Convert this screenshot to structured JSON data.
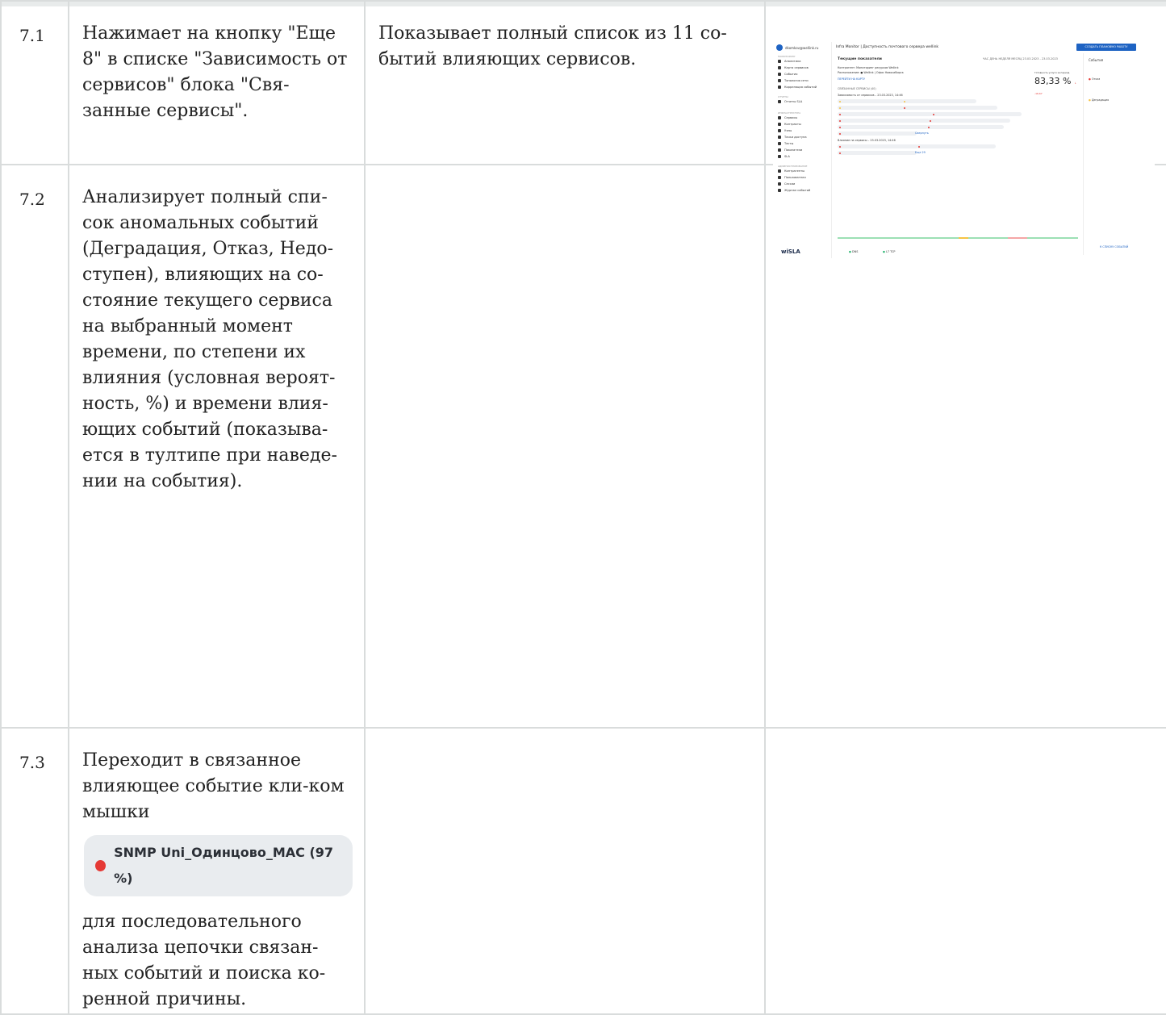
{
  "rows": [
    {
      "num": "7.1",
      "action": "Нажимает на кнопку \"Еще 8\" в списке \"Зависимость от сервисов\" блока \"Свя-занные сервисы\".",
      "result": "Показывает полный список из 11 со-бытий влияющих сервисов."
    },
    {
      "num": "7.2",
      "action": "Анализирует полный спи-сок аномальных событий (Деградация, Отказ, Недо-ступен), влияющих на со-стояние текущего сервиса на выбранный момент времени, по степени их влияния (условная вероят-ность, %) и времени влия-ющих событий (показыва-ется в тултипе при наведе-нии на события).",
      "result": ""
    },
    {
      "num": "7.3",
      "action_before": "Переходит в связанное влияющее событие кли-ком мышки",
      "chip": "SNMP Uni_Одинцово_MAC (97 %)",
      "action_after": "для последовательного анализа цепочки связан-ных событий и поиска ко-ренной причины.",
      "result": ""
    }
  ],
  "screenshot": {
    "user": "dkomkov@wellink.ru",
    "breadcrumb": "Infra Monitor | Доступность почтового сервера wellink",
    "create_button": "СОЗДАТЬ ПЛАНОВУЮ РАБОТУ",
    "sidebar": {
      "section_monitoring": "МОНИТОРИНГ",
      "items_monitoring": [
        "Аналитика",
        "Карта сервисов",
        "События",
        "Топология сети",
        "Корреляция событий"
      ],
      "section_reports": "ОТЧЕТЫ",
      "items_reports": [
        "Отчеты SLA"
      ],
      "section_infra": "ИНФРАСТРУКТУРА",
      "items_infra": [
        "Сервисы",
        "Контракты",
        "Узлы",
        "Точки доступа",
        "Тесты",
        "Показатели",
        "SLA"
      ],
      "section_admin": "АДМИНИСТРИРОВАНИЕ",
      "items_admin": [
        "Контрагенты",
        "Пользователи",
        "Сессии",
        "Журнал событий"
      ],
      "logo": "wiSLA"
    },
    "main": {
      "title": "Текущие показатели",
      "tabs": "ЧАС   ДЕНЬ   НЕДЕЛЯ   МЕСЯЦ   23.03.2023 - 23.03.2023",
      "contractor": "Контрагент: Мониторинг ресурсов Wellink",
      "location": "Расположение: ● Wellink | Офис Новосибирск",
      "goto_map": "ПЕРЕЙТИ НА КАРТУ",
      "availability_label": "Готовность услуги за период",
      "availability": "83,33 %",
      "availability_delta": "↓ -16,67",
      "related_header": "СВЯЗАННЫЕ СЕРВИСЫ (40)",
      "depends_label": "Зависимость от сервисов – 23.03.2023, 14:46",
      "influence_label": "Влияние на сервисы – 23.03.2023, 14:46",
      "collapse": "Свернуть",
      "more": "Еще 29",
      "legend_dns": "DNS",
      "legend_tcp": "L7 TCP"
    },
    "right": {
      "title": "События",
      "event1": "Отказ",
      "event2": "Деградация",
      "link": "К СПИСКУ СОБЫТИЙ"
    },
    "colors": {
      "accent": "#1e63c3",
      "red": "#e53935",
      "yellow": "#f6c343",
      "green": "#2bb673"
    }
  }
}
